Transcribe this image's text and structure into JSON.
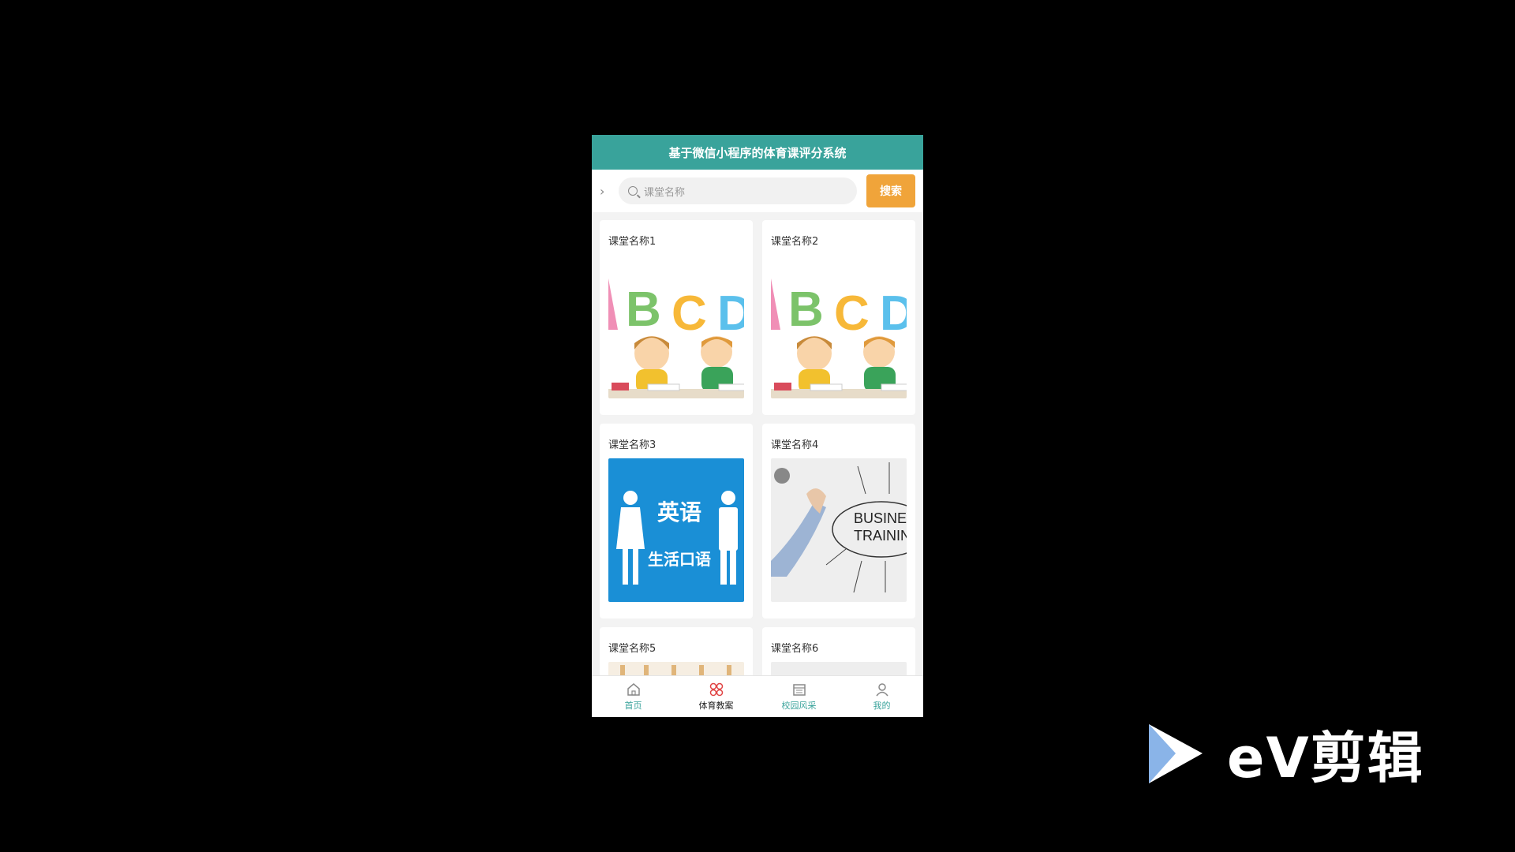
{
  "app": {
    "title": "基于微信小程序的体育课评分系统"
  },
  "search": {
    "placeholder": "课堂名称",
    "button_label": "搜索"
  },
  "courses": [
    {
      "name": "课堂名称1",
      "image": "kids-abc"
    },
    {
      "name": "课堂名称2",
      "image": "kids-abc"
    },
    {
      "name": "课堂名称3",
      "image": "english-speaking"
    },
    {
      "name": "课堂名称4",
      "image": "business-training"
    },
    {
      "name": "课堂名称5",
      "image": "beige-pattern"
    },
    {
      "name": "课堂名称6",
      "image": "grey-pattern"
    }
  ],
  "thumbnail_text": {
    "english_big": "英语",
    "english_small": "生活口语",
    "business": "BUSINESS TRAINING"
  },
  "tabbar": [
    {
      "label": "首页",
      "icon": "home-icon",
      "active": false
    },
    {
      "label": "体育教案",
      "icon": "grid-icon",
      "active": true
    },
    {
      "label": "校园风采",
      "icon": "calendar-icon",
      "active": false
    },
    {
      "label": "我的",
      "icon": "user-icon",
      "active": false
    }
  ],
  "watermark": {
    "brand": "eV剪辑"
  },
  "colors": {
    "header": "#39a39b",
    "search_button": "#f0a43a",
    "active_tab_icon": "#e04444",
    "tab_text": "#39a39b"
  }
}
